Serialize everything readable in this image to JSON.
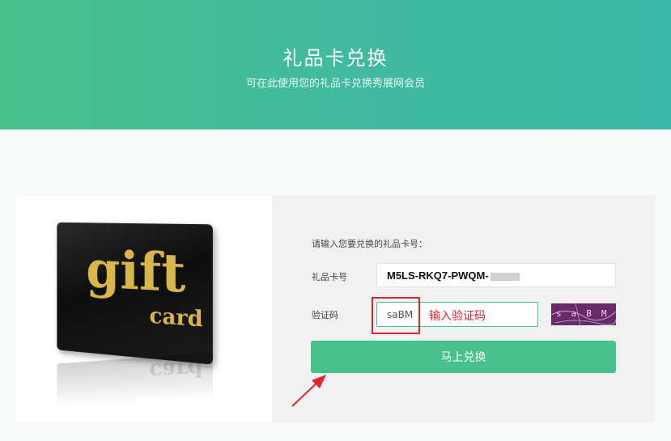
{
  "hero": {
    "title": "礼品卡兑换",
    "subtitle": "可在此使用您的礼品卡兑换秀展网会员"
  },
  "gift_card": {
    "word_gift": "gift",
    "word_card": "card"
  },
  "form": {
    "prompt": "请输入您要兑换的礼品卡号：",
    "card_label": "礼品卡号",
    "card_value": "M5LS-RKQ7-PWQM-",
    "captcha_label": "验证码",
    "captcha_value": "saBM",
    "captcha_hint": "输入验证码",
    "captcha_image_text": "saBM",
    "submit_label": "马上兑换"
  },
  "colors": {
    "accent": "#47c18c",
    "annotation": "#e0262d"
  }
}
